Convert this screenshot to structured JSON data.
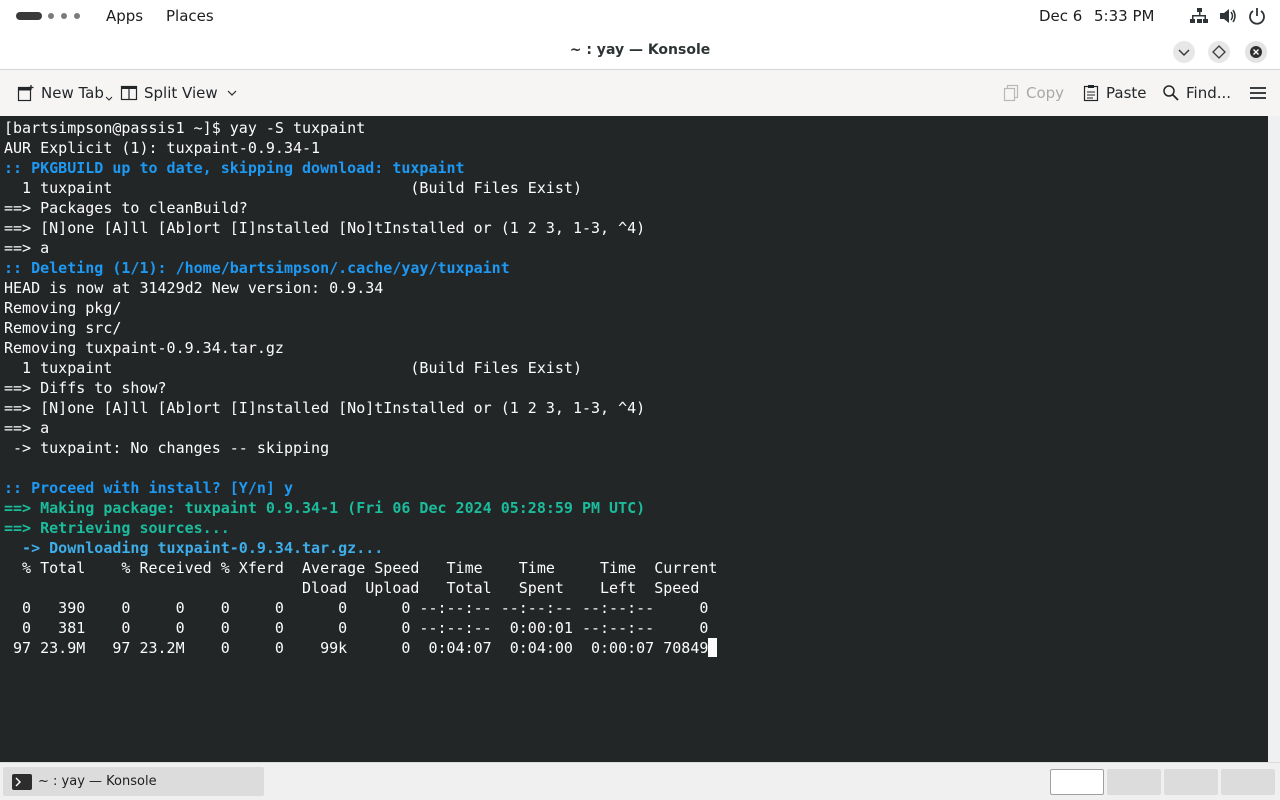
{
  "topbar": {
    "apps": "Apps",
    "places": "Places",
    "date": "Dec 6",
    "time": "5:33 PM"
  },
  "window": {
    "title": "~ : yay — Konsole"
  },
  "toolbar": {
    "new_tab": "New Tab",
    "split_view": "Split View",
    "copy": "Copy",
    "paste": "Paste",
    "find": "Find..."
  },
  "terminal": {
    "lines": [
      {
        "text": "[bartsimpson@passis1 ~]$ yay -S tuxpaint",
        "style": "plain"
      },
      {
        "text": "AUR Explicit (1): tuxpaint-0.9.34-1",
        "style": "plain"
      },
      {
        "text": ":: PKGBUILD up to date, skipping download: tuxpaint",
        "style": "blue"
      },
      {
        "text": "  1 tuxpaint                                 (Build Files Exist)",
        "style": "plain"
      },
      {
        "text": "==> Packages to cleanBuild?",
        "style": "plain"
      },
      {
        "text": "==> [N]one [A]ll [Ab]ort [I]nstalled [No]tInstalled or (1 2 3, 1-3, ^4)",
        "style": "plain"
      },
      {
        "text": "==> a",
        "style": "plain"
      },
      {
        "text": ":: Deleting (1/1): /home/bartsimpson/.cache/yay/tuxpaint",
        "style": "blue"
      },
      {
        "text": "HEAD is now at 31429d2 New version: 0.9.34",
        "style": "plain"
      },
      {
        "text": "Removing pkg/",
        "style": "plain"
      },
      {
        "text": "Removing src/",
        "style": "plain"
      },
      {
        "text": "Removing tuxpaint-0.9.34.tar.gz",
        "style": "plain"
      },
      {
        "text": "  1 tuxpaint                                 (Build Files Exist)",
        "style": "plain"
      },
      {
        "text": "==> Diffs to show?",
        "style": "plain"
      },
      {
        "text": "==> [N]one [A]ll [Ab]ort [I]nstalled [No]tInstalled or (1 2 3, 1-3, ^4)",
        "style": "plain"
      },
      {
        "text": "==> a",
        "style": "plain"
      },
      {
        "text": " -> tuxpaint: No changes -- skipping",
        "style": "plain"
      },
      {
        "text": "",
        "style": "plain"
      },
      {
        "text": ":: Proceed with install? [Y/n] y",
        "style": "blue"
      },
      {
        "text": "==> Making package: tuxpaint 0.9.34-1 (Fri 06 Dec 2024 05:28:59 PM UTC)",
        "style": "cyan"
      },
      {
        "text": "==> Retrieving sources...",
        "style": "cyan"
      },
      {
        "text": "  -> Downloading tuxpaint-0.9.34.tar.gz...",
        "style": "lblue"
      },
      {
        "text": "  % Total    % Received % Xferd  Average Speed   Time    Time     Time  Current",
        "style": "plain"
      },
      {
        "text": "                                 Dload  Upload   Total   Spent    Left  Speed",
        "style": "plain"
      },
      {
        "text": "  0   390    0     0    0     0      0      0 --:--:-- --:--:-- --:--:--     0",
        "style": "plain"
      },
      {
        "text": "  0   381    0     0    0     0      0      0 --:--:--  0:00:01 --:--:--     0",
        "style": "plain"
      },
      {
        "text": " 97 23.9M   97 23.2M    0     0    99k      0  0:04:07  0:04:00  0:00:07 70849",
        "style": "plain"
      }
    ]
  },
  "taskbar": {
    "konsole_task": "~ : yay — Konsole"
  }
}
